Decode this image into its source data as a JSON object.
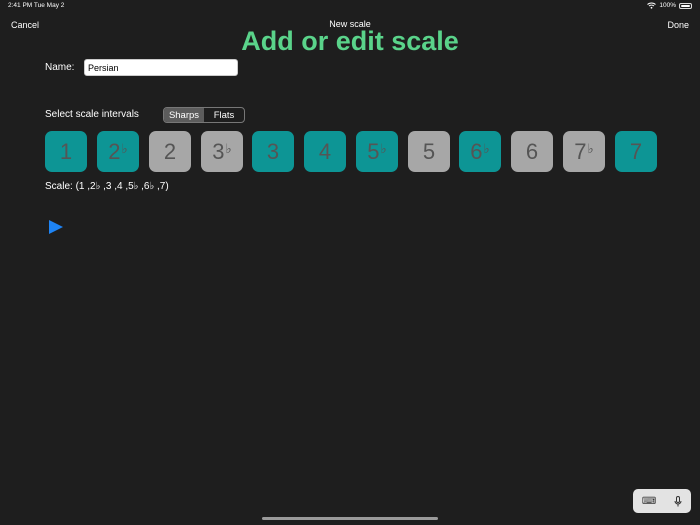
{
  "status_bar": {
    "time_date": "2:41 PM   Tue May 2",
    "battery": "100%"
  },
  "nav": {
    "cancel": "Cancel",
    "title": "New scale",
    "done": "Done"
  },
  "heading": "Add or edit scale",
  "name_field": {
    "label": "Name:",
    "value": "Persian"
  },
  "intervals": {
    "label": "Select scale intervals",
    "segments": [
      "Sharps",
      "Flats"
    ],
    "selected": "Sharps",
    "buttons": [
      {
        "num": "1",
        "acc": "",
        "on": true
      },
      {
        "num": "2",
        "acc": "♭",
        "on": true
      },
      {
        "num": "2",
        "acc": "",
        "on": false
      },
      {
        "num": "3",
        "acc": "♭",
        "on": false
      },
      {
        "num": "3",
        "acc": "",
        "on": true
      },
      {
        "num": "4",
        "acc": "",
        "on": true
      },
      {
        "num": "5",
        "acc": "♭",
        "on": true
      },
      {
        "num": "5",
        "acc": "",
        "on": false
      },
      {
        "num": "6",
        "acc": "♭",
        "on": true
      },
      {
        "num": "6",
        "acc": "",
        "on": false
      },
      {
        "num": "7",
        "acc": "♭",
        "on": false
      },
      {
        "num": "7",
        "acc": "",
        "on": true
      }
    ]
  },
  "scale_text": "Scale:  (1 ,2♭ ,3 ,4 ,5♭ ,6♭ ,7)",
  "colors": {
    "accent_green": "#5ad38a",
    "interval_on": "#0d9595",
    "interval_off": "#a7a7a7",
    "play_blue": "#1e84f5"
  },
  "icons": {
    "play": "play-icon",
    "keyboard": "keyboard-icon",
    "microphone": "microphone-icon",
    "wifi": "wifi-icon"
  }
}
